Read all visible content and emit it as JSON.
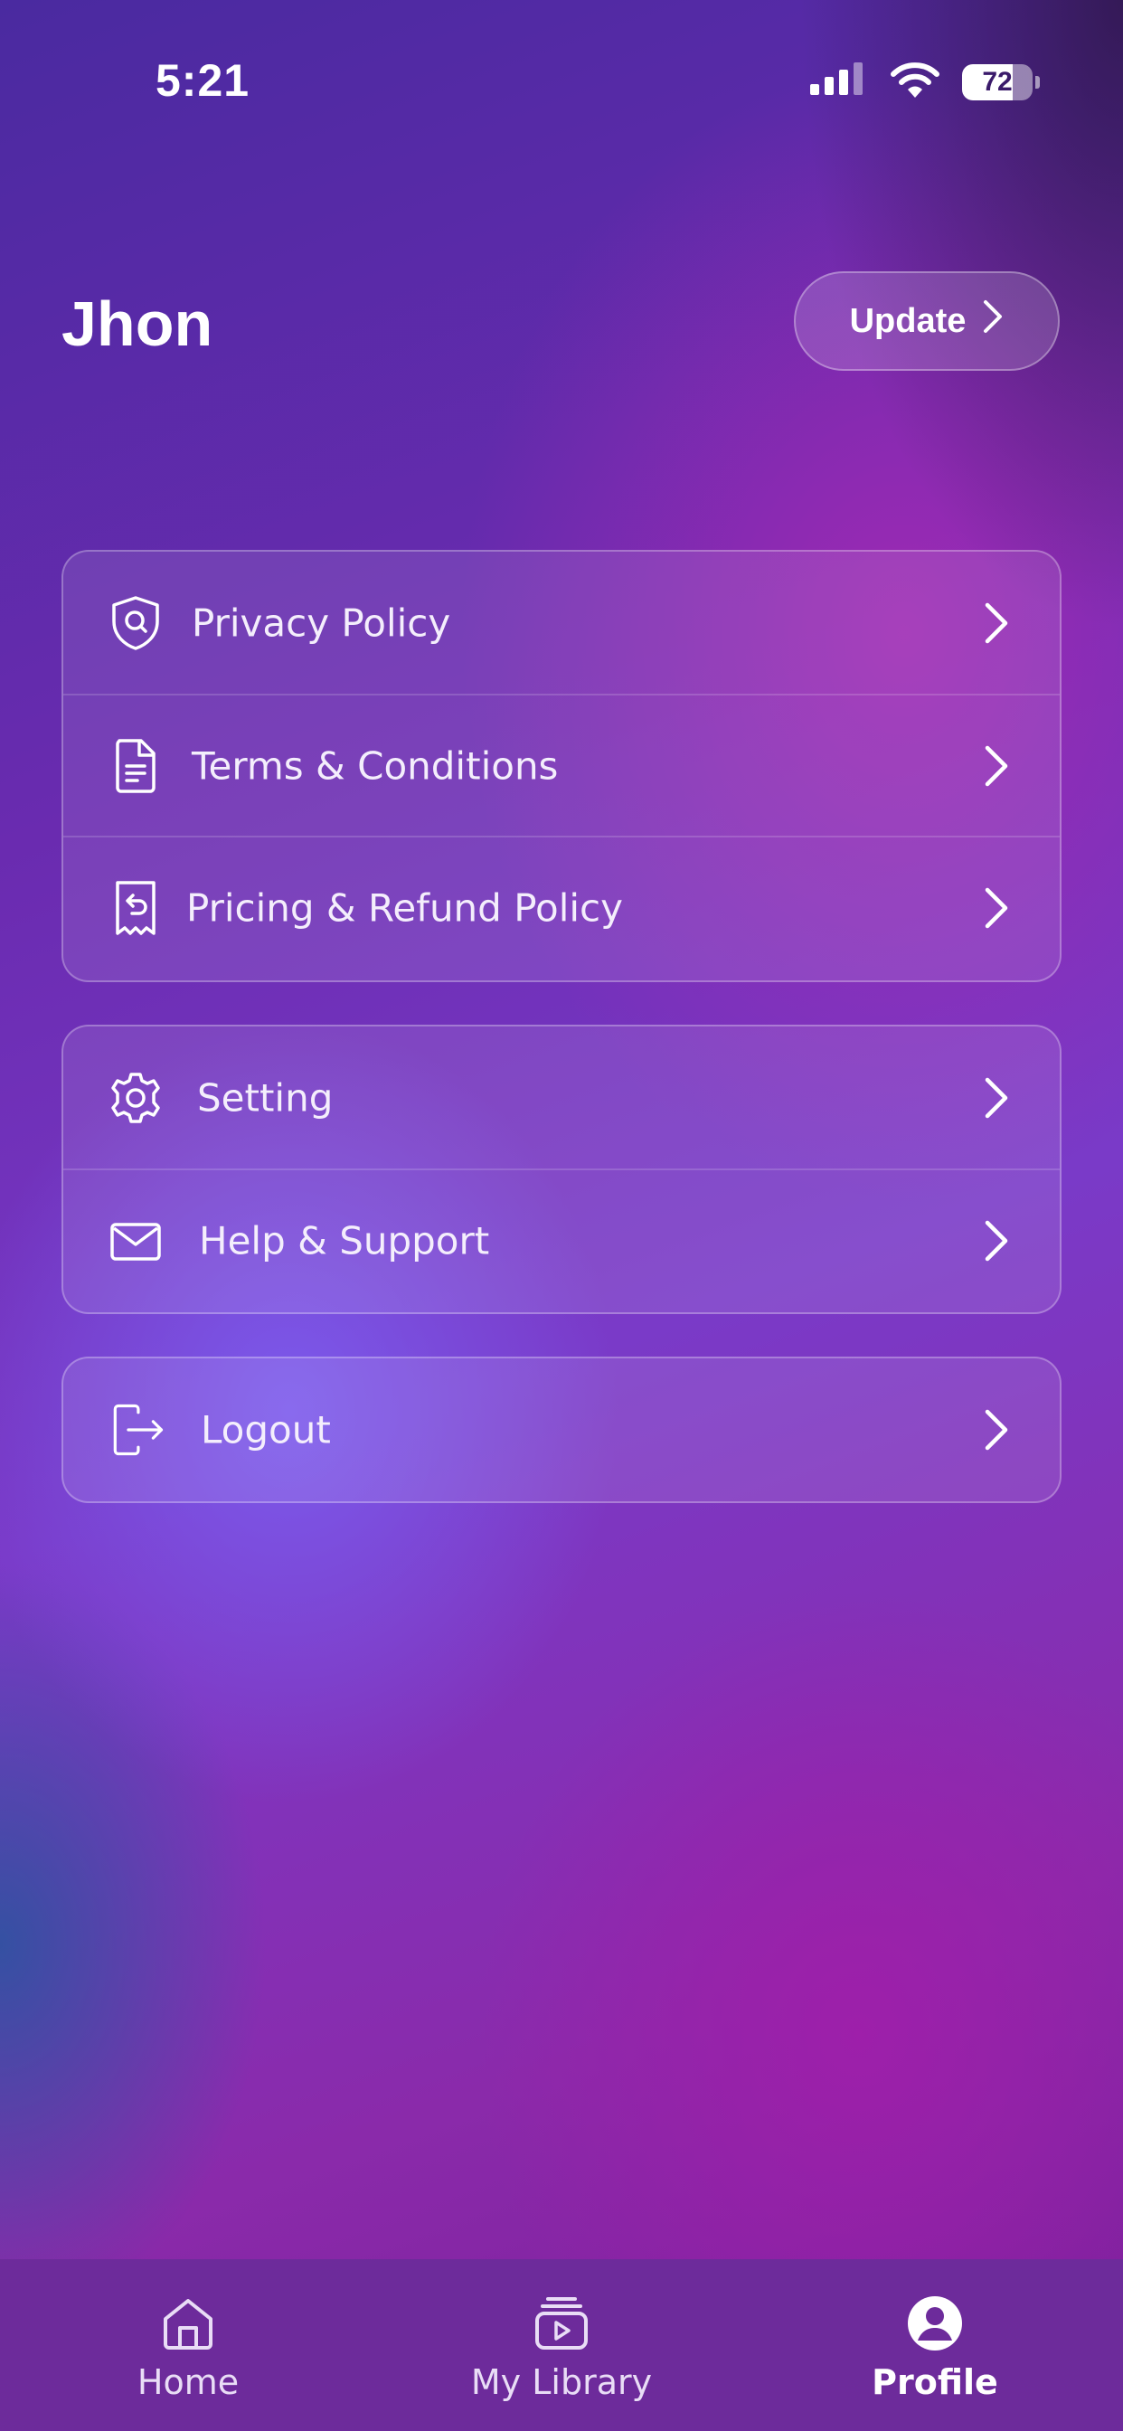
{
  "status_bar": {
    "time": "5:21",
    "battery": "72"
  },
  "header": {
    "user_name": "Jhon",
    "update_label": "Update"
  },
  "menu_groups": [
    {
      "items": [
        {
          "label": "Privacy Policy",
          "icon": "shield-search-icon"
        },
        {
          "label": "Terms & Conditions",
          "icon": "document-icon"
        },
        {
          "label": "Pricing & Refund Policy",
          "icon": "receipt-refund-icon"
        }
      ]
    },
    {
      "items": [
        {
          "label": "Setting",
          "icon": "gear-icon"
        },
        {
          "label": "Help & Support",
          "icon": "mail-icon"
        }
      ]
    },
    {
      "items": [
        {
          "label": "Logout",
          "icon": "logout-icon"
        }
      ]
    }
  ],
  "tabs": [
    {
      "label": "Home",
      "icon": "home-icon",
      "active": false
    },
    {
      "label": "My Library",
      "icon": "library-play-icon",
      "active": false
    },
    {
      "label": "Profile",
      "icon": "profile-icon",
      "active": true
    }
  ],
  "colors": {
    "tabbar_bg": "#6d2b9b",
    "text": "#ffffff"
  }
}
